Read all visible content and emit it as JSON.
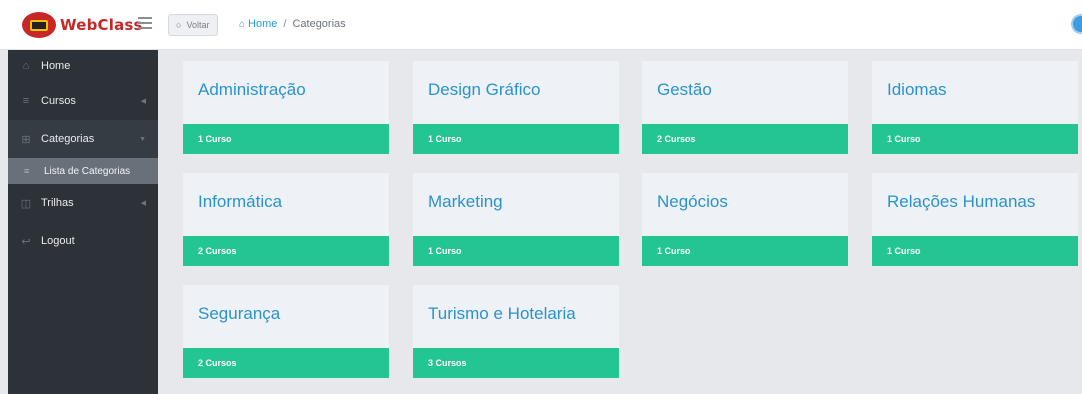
{
  "app": {
    "logo_text": "WebClass",
    "colors": {
      "brand": "#c62828",
      "accent": "#23c693",
      "link": "#2b93cb",
      "sidebar": "#2c3238"
    }
  },
  "header": {
    "menu_icon": "hamburger-icon",
    "back_label": "Voltar",
    "breadcrumb": {
      "home": "Home",
      "separator": "/",
      "current": "Categorias"
    },
    "user_icon": "user-avatar-icon"
  },
  "sidebar": {
    "items": [
      {
        "label": "Home",
        "icon": "home-icon"
      },
      {
        "label": "Cursos",
        "icon": "list-icon"
      },
      {
        "label": "Categorias",
        "icon": "grid-icon"
      },
      {
        "label": "Lista de Categorias",
        "icon": "list-icon"
      },
      {
        "label": "Trilhas",
        "icon": "columns-icon"
      },
      {
        "label": "Logout",
        "icon": "logout-icon"
      }
    ]
  },
  "categories": [
    {
      "name": "Administração",
      "count": "1 Curso"
    },
    {
      "name": "Design Gráfico",
      "count": "1 Curso"
    },
    {
      "name": "Gestão",
      "count": "2 Cursos"
    },
    {
      "name": "Idiomas",
      "count": "1 Curso"
    },
    {
      "name": "Informática",
      "count": "2 Cursos"
    },
    {
      "name": "Marketing",
      "count": "1 Curso"
    },
    {
      "name": "Negócios",
      "count": "1 Curso"
    },
    {
      "name": "Relações Humanas",
      "count": "1 Curso"
    },
    {
      "name": "Segurança",
      "count": "2 Cursos"
    },
    {
      "name": "Turismo e Hotelaria",
      "count": "3 Cursos"
    }
  ]
}
